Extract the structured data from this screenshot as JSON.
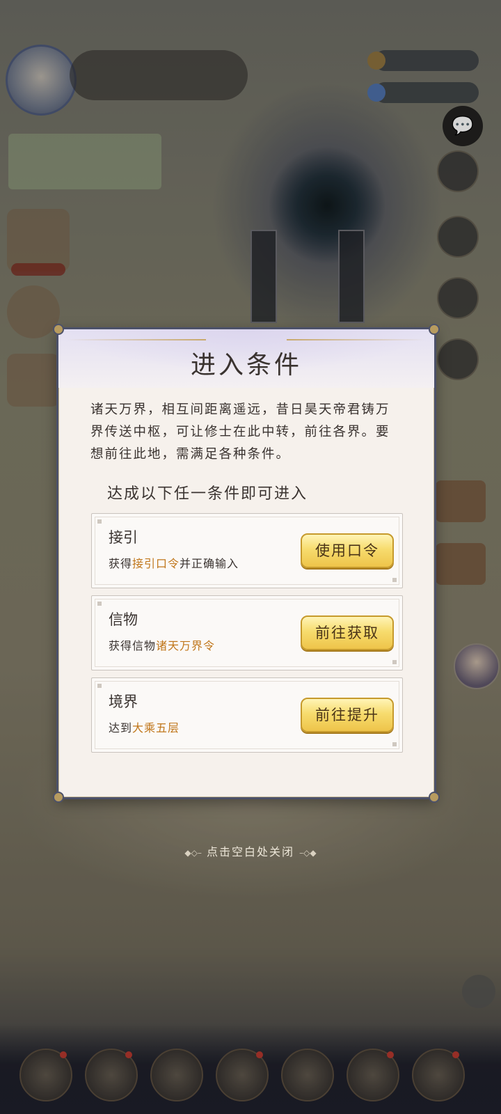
{
  "modal": {
    "title": "进入条件",
    "description": "诸天万界，相互间距离遥远，昔日昊天帝君铸万界传送中枢，可让修士在此中转，前往各界。要想前往此地，需满足各种条件。",
    "conditions_heading": "达成以下任一条件即可进入",
    "conditions": [
      {
        "title": "接引",
        "desc_prefix": "获得",
        "desc_highlight": "接引口令",
        "desc_suffix": "并正确输入",
        "button": "使用口令"
      },
      {
        "title": "信物",
        "desc_prefix": "获得信物",
        "desc_highlight": "诸天万界令",
        "desc_suffix": "",
        "button": "前往获取"
      },
      {
        "title": "境界",
        "desc_prefix": "达到",
        "desc_highlight": "大乘五层",
        "desc_suffix": "",
        "button": "前往提升"
      }
    ]
  },
  "close_hint": "点击空白处关闭",
  "colors": {
    "modal_border": "#4c5169",
    "highlight": "#c0761a",
    "button_gold": "#f7dc6e",
    "text": "#3a3330"
  }
}
